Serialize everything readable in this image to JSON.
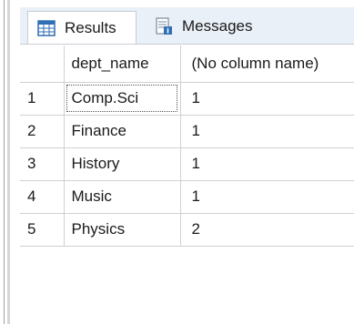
{
  "tabs": [
    {
      "label": "Results",
      "icon": "grid-results-icon",
      "active": true
    },
    {
      "label": "Messages",
      "icon": "messages-icon",
      "active": false
    }
  ],
  "grid": {
    "columns": [
      "",
      "dept_name",
      "(No column name)"
    ],
    "rows": [
      {
        "num": "1",
        "dept_name": "Comp.Sci",
        "count": "1"
      },
      {
        "num": "2",
        "dept_name": "Finance",
        "count": "1"
      },
      {
        "num": "3",
        "dept_name": "History",
        "count": "1"
      },
      {
        "num": "4",
        "dept_name": "Music",
        "count": "1"
      },
      {
        "num": "5",
        "dept_name": "Physics",
        "count": "2"
      }
    ]
  },
  "colors": {
    "tab_strip_bg": "#eaf0f7",
    "grid_line": "#d0d0d0",
    "icon_blue": "#2f6fb3"
  }
}
